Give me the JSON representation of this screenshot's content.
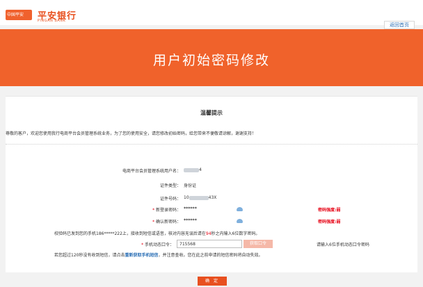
{
  "header": {
    "logo_text": "中国平安",
    "brand_cn": "平安银行",
    "brand_en": "PINGAN BANK",
    "home_button": "返回首页"
  },
  "banner": {
    "title": "用户初始密码修改"
  },
  "notice": {
    "title": "温馨提示",
    "body": "尊敬的客户，欢迎您使用我行电商平台会员管理系统业务，为了您的使用安全，请您修改初始密码，给您带来不便敬请谅解，谢谢支持！"
  },
  "form": {
    "username": {
      "label": "电商平台会员管理系统用户名：",
      "value_suffix": "4"
    },
    "id_type": {
      "label": "证件类型：",
      "value": "身份证"
    },
    "id_number": {
      "label": "证件号码：",
      "value_prefix": "10",
      "value_suffix": "43X"
    },
    "new_password": {
      "label": "新登录密码：",
      "value": "******",
      "strength": "密码强度:弱"
    },
    "confirm_password": {
      "label": "确认新密码：",
      "value": "******",
      "strength": "密码强度:弱"
    },
    "sms_notice": {
      "part1": "校验码已发到您的手机186*****222上，接收到短信或语音，核对内容无误后请在",
      "seconds": "94",
      "part2": "秒之内输入6位数字密码。"
    },
    "sms_code": {
      "label": "手机动态口令：",
      "value": "715568",
      "resend_button": "获取口令",
      "hint": "请输入6位手机动态口令密码"
    },
    "bottom_notice": {
      "part1": "若您超过120秒没有收到短信，请点击",
      "link": "重新获取手机短信",
      "part2": "，并注意查收。您在此之前申请的短信密码将自动失效。"
    }
  },
  "actions": {
    "confirm": "确 定"
  },
  "colors": {
    "accent": "#f0622b",
    "warning": "#e60012",
    "link": "#2b6fb5"
  }
}
